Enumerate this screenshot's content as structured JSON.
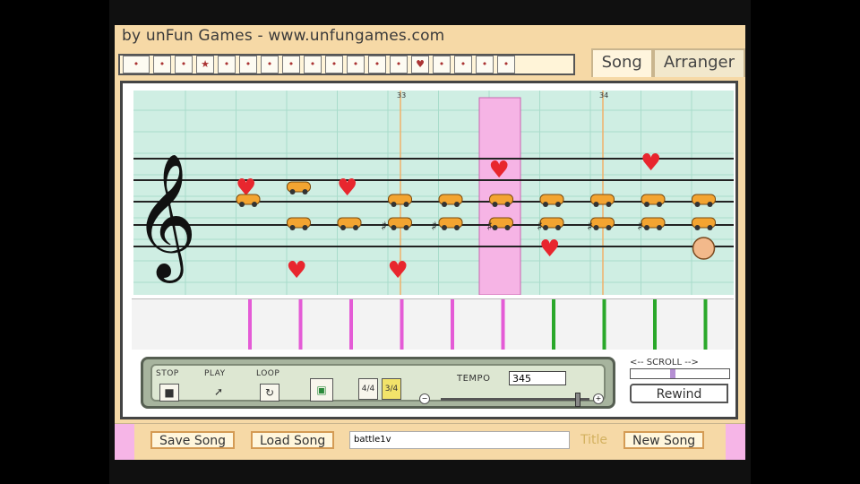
{
  "banner_text": "by unFun Games - www.unfungames.com",
  "tabs": [
    {
      "label": "Song",
      "active": true
    },
    {
      "label": "Arranger",
      "active": false
    }
  ],
  "toolbar_icons": [
    "mario-icon",
    "mushroom-icon",
    "yoshi-icon",
    "star-icon",
    "flower-icon",
    "coin-icon",
    "gameboy-icon",
    "dog-icon",
    "cat-icon",
    "pig-icon",
    "boo-icon",
    "ship-icon",
    "car-icon",
    "heart-icon",
    "plane-icon",
    "ghost-icon",
    "baby-icon",
    "stamp-icon"
  ],
  "staff": {
    "measure_numbers": [
      "33",
      "34"
    ],
    "notes": [
      {
        "icon": "heart",
        "beat": 1,
        "line": "b2"
      },
      {
        "icon": "car",
        "beat": 1,
        "line": "b1"
      },
      {
        "icon": "car",
        "beat": 2,
        "line": "b2"
      },
      {
        "icon": "car",
        "beat": 2,
        "line": "c"
      },
      {
        "icon": "heart",
        "beat": 2,
        "line": "d"
      },
      {
        "icon": "heart",
        "beat": 3,
        "line": "b2"
      },
      {
        "icon": "car",
        "beat": 3,
        "line": "c"
      },
      {
        "icon": "car",
        "beat": 4,
        "line": "b1"
      },
      {
        "icon": "car",
        "beat": 4,
        "line": "c"
      },
      {
        "icon": "heart",
        "beat": 4,
        "line": "d"
      },
      {
        "icon": "car",
        "beat": 5,
        "line": "b1"
      },
      {
        "icon": "car",
        "beat": 5,
        "line": "c"
      },
      {
        "icon": "heart",
        "beat": 6,
        "line": "top"
      },
      {
        "icon": "car",
        "beat": 6,
        "line": "b1"
      },
      {
        "icon": "car",
        "beat": 6,
        "line": "c"
      },
      {
        "icon": "car",
        "beat": 7,
        "line": "b1"
      },
      {
        "icon": "car",
        "beat": 7,
        "line": "c"
      },
      {
        "icon": "heart",
        "beat": 7,
        "line": "cd"
      },
      {
        "icon": "car",
        "beat": 8,
        "line": "b1"
      },
      {
        "icon": "car",
        "beat": 8,
        "line": "c"
      },
      {
        "icon": "heart",
        "beat": 9,
        "line": "topp"
      },
      {
        "icon": "car",
        "beat": 9,
        "line": "b1"
      },
      {
        "icon": "car",
        "beat": 9,
        "line": "c"
      },
      {
        "icon": "car",
        "beat": 10,
        "line": "b1"
      },
      {
        "icon": "car",
        "beat": 10,
        "line": "c"
      },
      {
        "icon": "face",
        "beat": 10,
        "line": "cd"
      }
    ]
  },
  "controls": {
    "stop_label": "STOP",
    "play_label": "PLAY",
    "loop_label": "LOOP",
    "tempo_label": "TEMPO",
    "tempo_value": "345"
  },
  "scroll_label": "<-- SCROLL -->",
  "rewind_label": "Rewind",
  "bottom": {
    "save_label": "Save Song",
    "load_label": "Load Song",
    "title_value": "battle1v",
    "title_label": "Title",
    "new_label": "New Song"
  }
}
